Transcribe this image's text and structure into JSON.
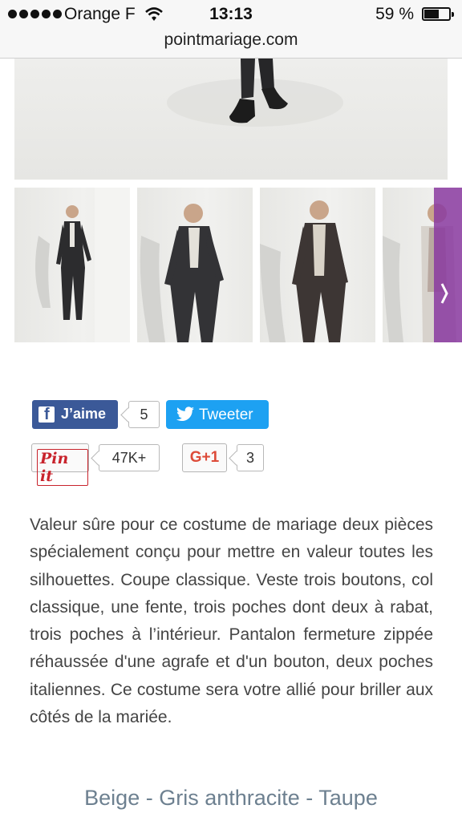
{
  "status_bar": {
    "carrier": "Orange F",
    "time": "13:13",
    "battery_percent": "59 %",
    "battery_level": 0.59
  },
  "browser": {
    "url": "pointmariage.com"
  },
  "gallery": {
    "thumbnails": [
      {
        "label": "suit-photo-1"
      },
      {
        "label": "suit-photo-2"
      },
      {
        "label": "suit-photo-3"
      },
      {
        "label": "suit-photo-4"
      }
    ]
  },
  "share": {
    "facebook_label": "J’aime",
    "facebook_count": "5",
    "twitter_label": "Tweeter",
    "pinterest_label": "Pin it",
    "pinterest_count": "47K+",
    "gplus_label": "G+1",
    "gplus_count": "3"
  },
  "description": "Valeur sûre pour ce costume de mariage deux pièces spécialement conçu pour mettre en valeur toutes les silhouettes. Coupe classique. Veste trois boutons, col classique, une fente, trois poches dont deux à rabat, trois poches à l’intérieur. Pantalon fermeture zippée réhaussée d'une agrafe et d'un bouton, deux poches italiennes. Ce costume sera votre allié pour briller aux côtés de la mariée.",
  "colors_line": "Beige - Gris anthracite - Taupe",
  "palette": {
    "facebook": "#3b5998",
    "twitter": "#1da1f2",
    "pinterest": "#c8232c",
    "gplus": "#dd4b39",
    "colors_text": "#6d8090"
  }
}
